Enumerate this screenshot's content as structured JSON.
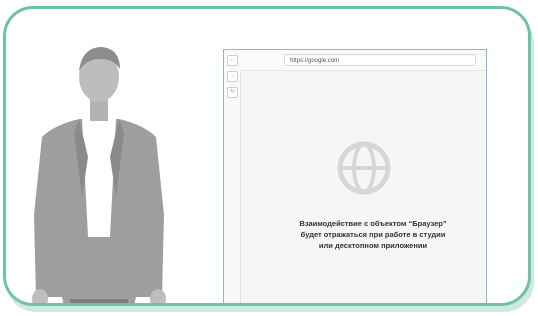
{
  "browser": {
    "url": "https://google.com",
    "nav": {
      "back_icon": "arrow-left-icon",
      "forward_icon": "arrow-right-icon",
      "refresh_icon": "refresh-icon",
      "back_glyph": "←",
      "forward_glyph": "→",
      "refresh_glyph": "↻"
    },
    "placeholder_icon": "globe-icon",
    "message_lines": [
      "Взаимодействие с объектом “Браузер”",
      "будет отражаться при работе в студии",
      "или десктопном приложении"
    ]
  },
  "colors": {
    "card_border": "#6fc2a3",
    "card_shadow": "#cfe9de",
    "browser_border": "#8fb4e0",
    "globe": "#d6d6d6"
  }
}
